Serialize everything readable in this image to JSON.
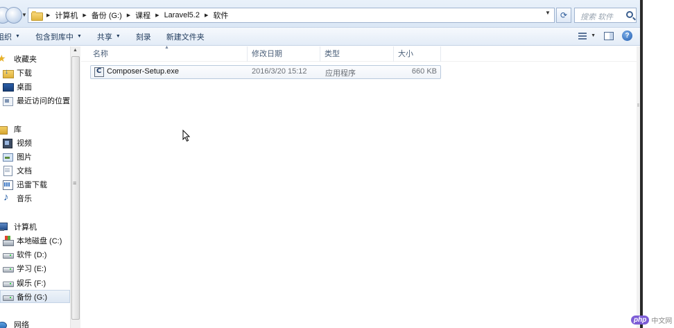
{
  "address_bar": {
    "crumbs": [
      "计算机",
      "备份 (G:)",
      "课程",
      "Laravel5.2",
      "软件"
    ],
    "search_placeholder": "搜索 软件"
  },
  "toolbar": {
    "organize_label": "组织",
    "include_label": "包含到库中",
    "share_label": "共享",
    "burn_label": "刻录",
    "new_folder_label": "新建文件夹"
  },
  "nav": {
    "favorites": {
      "label": "收藏夹",
      "items": [
        "下载",
        "桌面",
        "最近访问的位置"
      ]
    },
    "libraries": {
      "label": "库",
      "items": [
        "视频",
        "图片",
        "文档",
        "迅雷下载",
        "音乐"
      ]
    },
    "computer": {
      "label": "计算机",
      "items": [
        "本地磁盘 (C:)",
        "软件 (D:)",
        "学习 (E:)",
        "娱乐 (F:)",
        "备份 (G:)"
      ],
      "selected": "备份 (G:)"
    },
    "network": {
      "label": "网络"
    }
  },
  "columns": {
    "name": "名称",
    "date": "修改日期",
    "type": "类型",
    "size": "大小"
  },
  "files": [
    {
      "name": "Composer-Setup.exe",
      "date": "2016/3/20 15:12",
      "type": "应用程序",
      "size": "660 KB"
    }
  ],
  "watermark": {
    "logo": "php",
    "text": "中文网"
  },
  "colors": {
    "accent": "#1e395b",
    "selection_border": "#b9c9dd",
    "watermark_logo": "#7d5dd6"
  }
}
